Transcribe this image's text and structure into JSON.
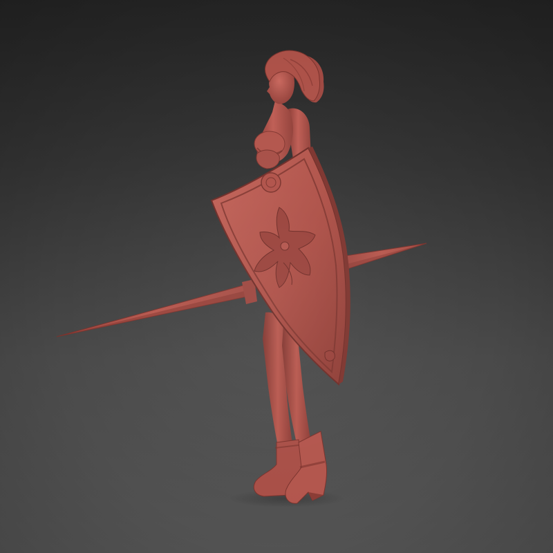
{
  "scene": {
    "subject": "sculpted-figure-with-shield-and-sword",
    "colors": {
      "background_top": "#252525",
      "background_bottom": "#535353",
      "clay_base": "#b4544c",
      "clay_light": "#c8675d",
      "clay_shadow": "#7e3530",
      "clay_deep": "#5e2622"
    }
  }
}
